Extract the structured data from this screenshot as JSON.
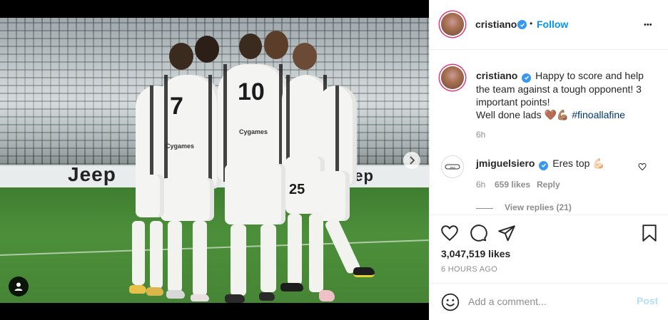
{
  "post": {
    "author": "cristiano",
    "follow_label": "Follow",
    "separator": "•",
    "more_label": "•••"
  },
  "caption": {
    "username": "cristiano",
    "text": "Happy to score and help the team against a tough opponent! 3 important points!",
    "line2_prefix": "Well done lads ",
    "line2_emoji": "🤎💪🏽",
    "hashtag": "#finoallafine",
    "time": "6h"
  },
  "comment": {
    "username": "jmiguelsiero",
    "text": "Eres top",
    "emoji": "💪🏻",
    "time": "6h",
    "likes": "659 likes",
    "reply_label": "Reply",
    "view_replies": "View replies (21)"
  },
  "photo": {
    "ad_text": "Jeep",
    "ad_text_right": "eep",
    "jersey_numbers": [
      "7",
      "10",
      "25"
    ],
    "sponsor": "Cygames"
  },
  "engagement": {
    "likes": "3,047,519 likes",
    "time_ago": "6 HOURS AGO"
  },
  "composer": {
    "placeholder": "Add a comment...",
    "post_label": "Post"
  },
  "colors": {
    "accent": "#0095f6",
    "verified": "#3897f0",
    "post_disabled": "#b2dffc",
    "hashtag": "#00376b",
    "muted": "#8e8e8e"
  },
  "icons": {
    "heart": "heart-icon",
    "comment": "comment-icon",
    "share": "paper-plane-icon",
    "save": "bookmark-icon",
    "emoji": "smiley-icon",
    "user_tag": "user-tag-icon",
    "next": "chevron-right-icon",
    "more": "more-options-icon"
  }
}
